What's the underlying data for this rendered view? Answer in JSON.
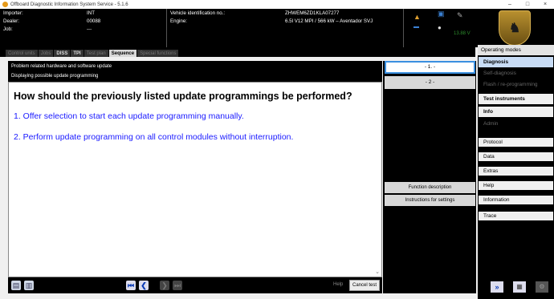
{
  "window": {
    "title": "Offboard Diagnostic Information System Service - 5.1.6",
    "minimize": "–",
    "maximize": "□",
    "close": "×"
  },
  "header": {
    "importer_label": "Importer:",
    "importer_value": "INT",
    "dealer_label": "Dealer:",
    "dealer_value": "00088",
    "job_label": "Job:",
    "job_value": "---",
    "vin_label": "Vehicle identification no.:",
    "vin_value": "ZHWEM6ZD1KLA07277",
    "engine_label": "Engine:",
    "engine_value": "6.5l V12 MPI / 566 kW – Aventador SVJ",
    "voltage": "13.88 V"
  },
  "tabs": [
    {
      "label": "Control units"
    },
    {
      "label": "Jobs"
    },
    {
      "label": "DISS"
    },
    {
      "label": "TPI"
    },
    {
      "label": "Test plan"
    },
    {
      "label": "Sequence"
    },
    {
      "label": "Special functions"
    }
  ],
  "content": {
    "header_line1": "Problem related hardware and software update",
    "header_line2": "Displaying possible update programming",
    "question": "How should the previously listed update programmings be performed?",
    "option1": "1. Offer selection to start each update programming manually.",
    "option2": "2. Perform update programming on all control modules without interruption."
  },
  "selection": {
    "option1": "- 1. -",
    "option2": "- 2 -",
    "function_description": "Function description",
    "instructions": "Instructions for settings"
  },
  "bottom": {
    "help": "Help",
    "cancel": "Cancel test"
  },
  "right_panel": {
    "operating_modes": "Operating modes",
    "diagnosis": "Diagnosis",
    "self_diagnosis": "Self-diagnosis",
    "flash": "Flash / re-programming",
    "test_instruments": "Test instruments",
    "info": "Info",
    "admin": "Admin",
    "protocol": "Protocol",
    "data": "Data",
    "extras": "Extras",
    "help": "Help",
    "information": "Information",
    "trace": "Trace"
  }
}
